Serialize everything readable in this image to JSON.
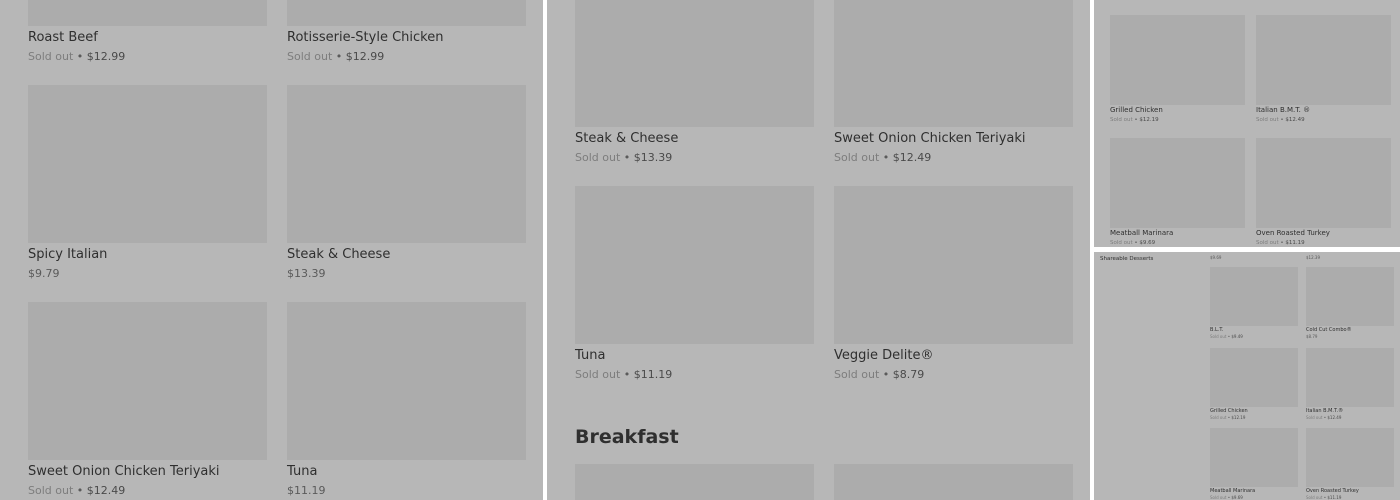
{
  "panel1": {
    "items": [
      {
        "name": "Roast Beef",
        "status": "Sold out",
        "price": "$12.99"
      },
      {
        "name": "Rotisserie-Style Chicken",
        "status": "Sold out",
        "price": "$12.99"
      },
      {
        "name": "Spicy Italian",
        "status": "",
        "price": "$9.79"
      },
      {
        "name": "Steak & Cheese",
        "status": "",
        "price": "$13.39"
      },
      {
        "name": "Sweet Onion Chicken Teriyaki",
        "status": "Sold out",
        "price": "$12.49"
      },
      {
        "name": "Tuna",
        "status": "",
        "price": "$11.19"
      }
    ]
  },
  "panel2": {
    "items": [
      {
        "name": "Steak & Cheese",
        "status": "Sold out",
        "price": "$13.39"
      },
      {
        "name": "Sweet Onion Chicken Teriyaki",
        "status": "Sold out",
        "price": "$12.49"
      },
      {
        "name": "Tuna",
        "status": "Sold out",
        "price": "$11.19"
      },
      {
        "name": "Veggie Delite®",
        "status": "Sold out",
        "price": "$8.79"
      }
    ],
    "section_title": "Breakfast"
  },
  "panel3": {
    "items": [
      {
        "name": "Grilled Chicken",
        "status": "Sold out",
        "price": "$12.19"
      },
      {
        "name": "Italian B.M.T. ®",
        "status": "Sold out",
        "price": "$12.49"
      },
      {
        "name": "Meatball Marinara",
        "status": "Sold out",
        "price": "$9.69"
      },
      {
        "name": "Oven Roasted Turkey",
        "status": "Sold out",
        "price": "$11.19"
      }
    ]
  },
  "panel4": {
    "section_title": "Shareable Desserts",
    "top_prices": [
      "$9.69",
      "$12.39"
    ],
    "items": [
      {
        "name": "B.L.T.",
        "status": "Sold out",
        "price": "$9.49"
      },
      {
        "name": "Cold Cut Combo®",
        "status": "",
        "price": "$8.79"
      },
      {
        "name": "Grilled Chicken",
        "status": "Sold out",
        "price": "$12.19"
      },
      {
        "name": "Italian B.M.T.®",
        "status": "Sold out",
        "price": "$12.49"
      },
      {
        "name": "Meatball Marinara",
        "status": "Sold out",
        "price": "$9.69"
      },
      {
        "name": "Oven Roasted Turkey",
        "status": "Sold out",
        "price": "$11.19"
      }
    ]
  }
}
